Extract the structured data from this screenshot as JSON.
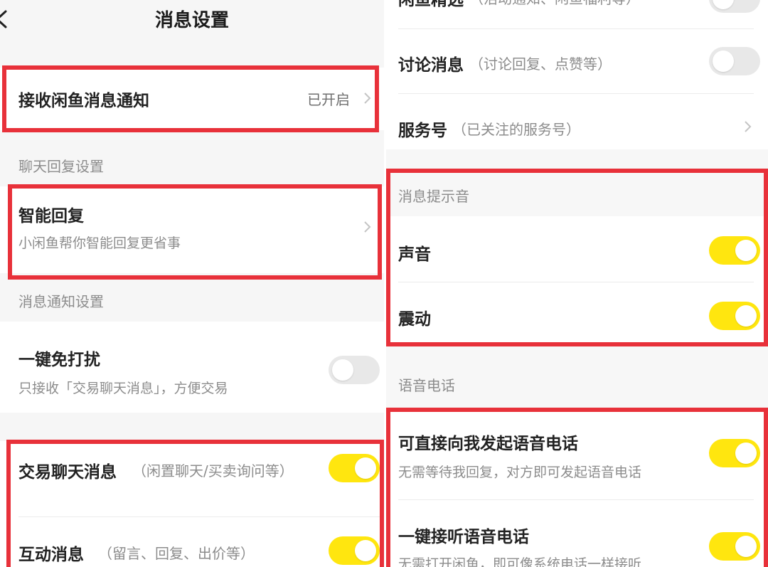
{
  "header": {
    "title": "消息设置"
  },
  "left": {
    "receive_notify": {
      "title": "接收闲鱼消息通知",
      "value": "已开启"
    },
    "chat_section": "聊天回复设置",
    "smart_reply": {
      "title": "智能回复",
      "subtitle": "小闲鱼帮你智能回复更省事"
    },
    "notify_section": "消息通知设置",
    "dnd": {
      "title": "一键免打扰",
      "subtitle": "只接收「交易聊天消息」，方便交易",
      "enabled": false
    },
    "trade_chat": {
      "title": "交易聊天消息",
      "note": "（闲置聊天/买卖询问等）",
      "enabled": true
    },
    "interaction": {
      "title": "互动消息",
      "note": "（留言、回复、出价等）",
      "enabled": true
    }
  },
  "right": {
    "idle_picks": {
      "title": "闲鱼精选",
      "note": "（活动通知、闲鱼福利等）",
      "enabled": false
    },
    "discussion": {
      "title": "讨论消息",
      "note": "（讨论回复、点赞等）",
      "enabled": false
    },
    "service": {
      "title": "服务号",
      "note": "（已关注的服务号）"
    },
    "sound_section": "消息提示音",
    "sound": {
      "title": "声音",
      "enabled": true
    },
    "vibration": {
      "title": "震动",
      "enabled": true
    },
    "voice_section": "语音电话",
    "direct_call": {
      "title": "可直接向我发起语音电话",
      "subtitle": "无需等待我回复，对方即可发起语音电话",
      "enabled": true
    },
    "auto_answer": {
      "title": "一键接听语音电话",
      "subtitle": "无需打开闲鱼，即可像系统电话一样接听",
      "enabled": true
    }
  },
  "colors": {
    "toggle_on": "#ffe60f",
    "toggle_off": "#e8e8e8",
    "highlight_box": "#e8313a"
  }
}
